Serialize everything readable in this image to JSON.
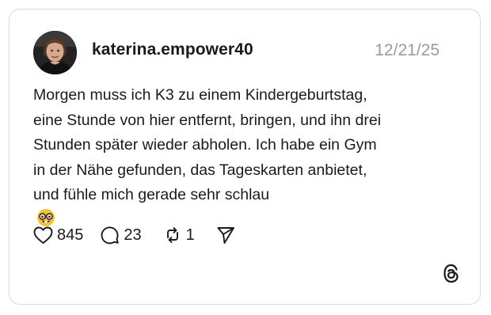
{
  "post": {
    "username": "katerina.empower40",
    "date": "12/21/25",
    "text_lines": [
      "Morgen muss ich K3 zu einem Kindergeburtstag,",
      "eine Stunde von hier entfernt, bringen, und ihn drei",
      "Stunden später wieder abholen. Ich habe ein Gym",
      "in der Nähe gefunden, das Tageskarten anbietet,",
      "und fühle mich gerade sehr schlau"
    ],
    "trailing_emoji": "nerd-face-icon"
  },
  "actions": {
    "likes": "845",
    "replies": "23",
    "reposts": "1"
  },
  "icons": {
    "like": "heart-icon",
    "reply": "speech-bubble-icon",
    "repost": "repost-icon",
    "share": "send-icon",
    "brand": "threads-logo-icon"
  },
  "colors": {
    "text": "#1a1a1a",
    "muted": "#9a9a9a",
    "border": "#d9d9d9",
    "emoji": "#f7c23a"
  }
}
